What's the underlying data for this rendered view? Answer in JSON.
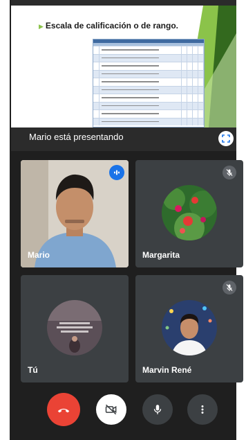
{
  "presentation": {
    "slide_title": "Escala de calificación o de rango.",
    "presenting_label": "Mario está presentando"
  },
  "participants": [
    {
      "name": "Mario",
      "mic": "speaking"
    },
    {
      "name": "Margarita",
      "mic": "muted"
    },
    {
      "name": "Tú",
      "mic": "on"
    },
    {
      "name": "Marvin René",
      "mic": "muted"
    }
  ],
  "controls": {
    "end_call": "phone-hangup-icon",
    "camera": "camera-off-icon",
    "mic": "microphone-icon",
    "more": "more-vert-icon"
  },
  "colors": {
    "background": "#1f1f1f",
    "tile": "#3c4043",
    "end_call": "#ea4335",
    "speaking": "#1a73e8"
  }
}
